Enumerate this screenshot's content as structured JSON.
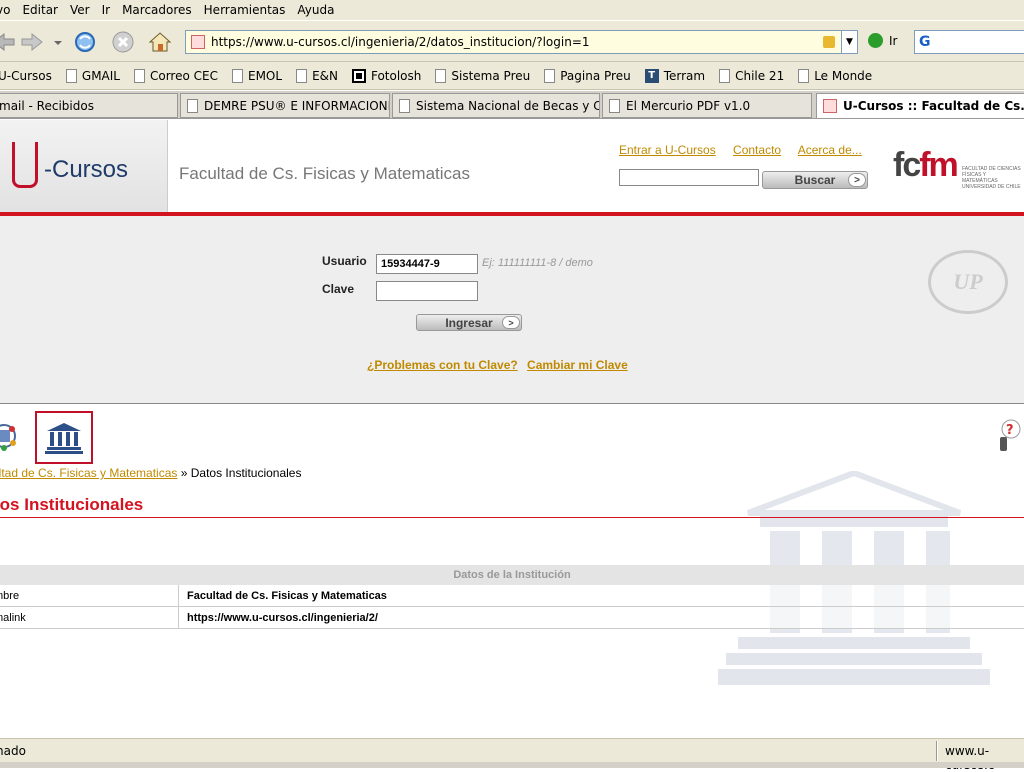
{
  "menu": [
    "vo",
    "Editar",
    "Ver",
    "Ir",
    "Marcadores",
    "Herramientas",
    "Ayuda"
  ],
  "address": {
    "url": "https://www.u-cursos.cl/ingenieria/2/datos_institucion/?login=1",
    "go_label": "Ir"
  },
  "bookmarks": [
    "U-Cursos",
    "GMAIL",
    "Correo CEC",
    "EMOL",
    "E&N",
    "Fotolosh",
    "Sistema Preu",
    "Pagina Preu",
    "Terram",
    "Chile 21",
    "Le Monde"
  ],
  "tabs": [
    {
      "label": "mail - Recibidos",
      "active": false
    },
    {
      "label": "DEMRE PSU® E INFORMACIONES",
      "active": false
    },
    {
      "label": "Sistema Nacional de Becas y Cr...",
      "active": false
    },
    {
      "label": "El Mercurio PDF v1.0",
      "active": false
    },
    {
      "label": "U-Cursos :: Facultad de Cs. F...",
      "active": true
    }
  ],
  "header": {
    "logo": "-Cursos",
    "faculty": "Facultad de Cs. Fisicas y Matematicas",
    "links": [
      "Entrar a U-Cursos",
      "Contacto",
      "Acerca de..."
    ],
    "search_button": "Buscar",
    "fcfm_logo": "fcfm",
    "fcfm_sub": "FACULTAD DE CIENCIAS FÍSICAS Y MATEMÁTICAS UNIVERSIDAD DE CHILE"
  },
  "login": {
    "user_label": "Usuario",
    "user_value": "15934447-9",
    "user_hint": "Ej: 111111111-8 / demo",
    "pass_label": "Clave",
    "submit": "Ingresar",
    "problems_link": "¿Problemas con tu Clave?",
    "change_link": "Cambiar mi Clave",
    "seal": "UP"
  },
  "breadcrumb": {
    "link": "ultad de Cs. Fisicas y Matematicas",
    "current": " » Datos Institucionales"
  },
  "section_title": "tos Institucionales",
  "table": {
    "header": "Datos de la Institución",
    "rows": [
      {
        "key": "mbre",
        "value": "Facultad de Cs. Fisicas y Matematicas"
      },
      {
        "key": "malink",
        "value": "https://www.u-cursos.cl/ingenieria/2/"
      }
    ]
  },
  "status": {
    "text": "nado",
    "host": "www.u-cursos.c"
  },
  "colors": {
    "accent_red": "#d3131f",
    "link_gold": "#c08a00",
    "logo_blue": "#1e3b6a"
  }
}
